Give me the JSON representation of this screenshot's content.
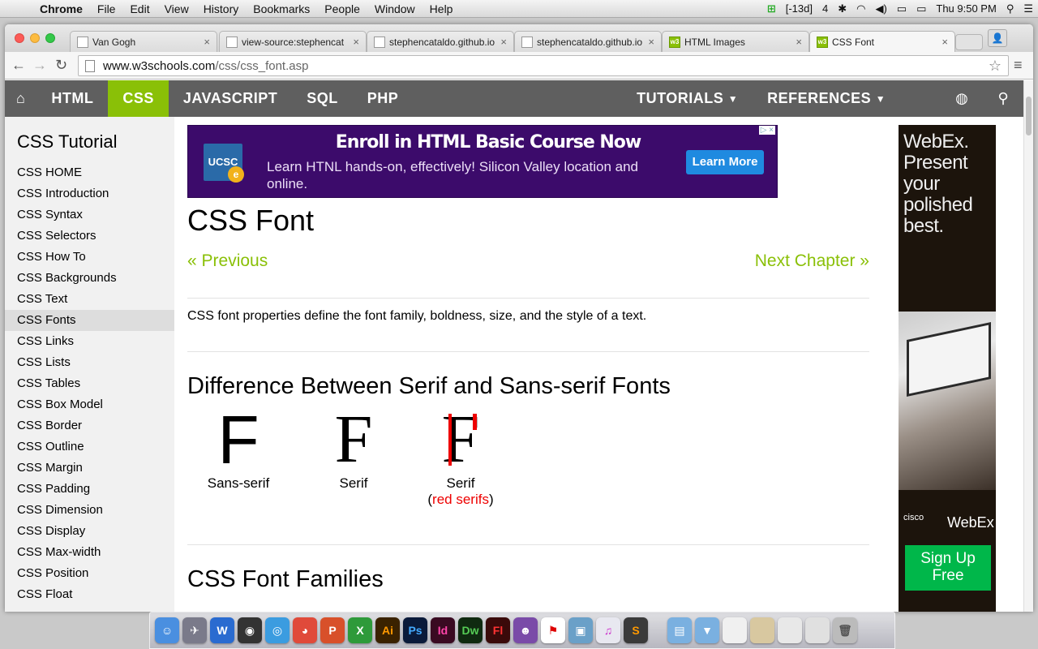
{
  "menubar": {
    "apple": "",
    "app": "Chrome",
    "items": [
      "File",
      "Edit",
      "View",
      "History",
      "Bookmarks",
      "People",
      "Window",
      "Help"
    ],
    "status": {
      "badge": "[-13d]",
      "count": "4",
      "clock": "Thu 9:50 PM"
    }
  },
  "tabs": [
    {
      "title": "Van Gogh",
      "icon": "page-icon"
    },
    {
      "title": "view-source:stephencat",
      "icon": "page-icon"
    },
    {
      "title": "stephencataldo.github.io",
      "icon": "page-icon"
    },
    {
      "title": "stephencataldo.github.io",
      "icon": "page-icon"
    },
    {
      "title": "HTML Images",
      "icon": "w3-icon"
    },
    {
      "title": "CSS Font",
      "icon": "w3-icon"
    }
  ],
  "address": {
    "host": "www.w3schools.com",
    "path": "/css/css_font.asp"
  },
  "topnav": {
    "items": [
      "HTML",
      "CSS",
      "JAVASCRIPT",
      "SQL",
      "PHP"
    ],
    "tutorials": "TUTORIALS",
    "references": "REFERENCES",
    "accent": "#8ac007",
    "bar_color": "#5f5f5f"
  },
  "sidebar": {
    "heading": "CSS Tutorial",
    "links": [
      "CSS HOME",
      "CSS Introduction",
      "CSS Syntax",
      "CSS Selectors",
      "CSS How To",
      "CSS Backgrounds",
      "CSS Text",
      "CSS Fonts",
      "CSS Links",
      "CSS Lists",
      "CSS Tables",
      "CSS Box Model",
      "CSS Border",
      "CSS Outline",
      "CSS Margin",
      "CSS Padding",
      "CSS Dimension",
      "CSS Display",
      "CSS Max-width",
      "CSS Position",
      "CSS Float"
    ],
    "active": "CSS Fonts"
  },
  "ad": {
    "logo": "UCSC",
    "headline": "Enroll in HTML Basic Course Now",
    "body": "Learn HTNL hands-on, effectively! Silicon Valley location and online.",
    "button": "Learn More"
  },
  "main": {
    "title": "CSS Font",
    "previous": "« Previous",
    "next": "Next Chapter »",
    "intro": "CSS font properties define the font family, boldness, size, and the style of a text.",
    "section1": "Difference Between Serif and Sans-serif Fonts",
    "demos": [
      {
        "glyph": "F",
        "label": "Sans-serif"
      },
      {
        "glyph": "F",
        "label": "Serif"
      },
      {
        "glyph": "F",
        "label": "Serif",
        "sub_open": "(",
        "sub_red": "red serifs",
        "sub_close": ")"
      }
    ],
    "section2": "CSS Font Families"
  },
  "right_ad": {
    "headline": "WebEx. Present your polished best.",
    "cisco": "cisco",
    "brand": "WebEx",
    "cta": "Sign Up Free"
  }
}
